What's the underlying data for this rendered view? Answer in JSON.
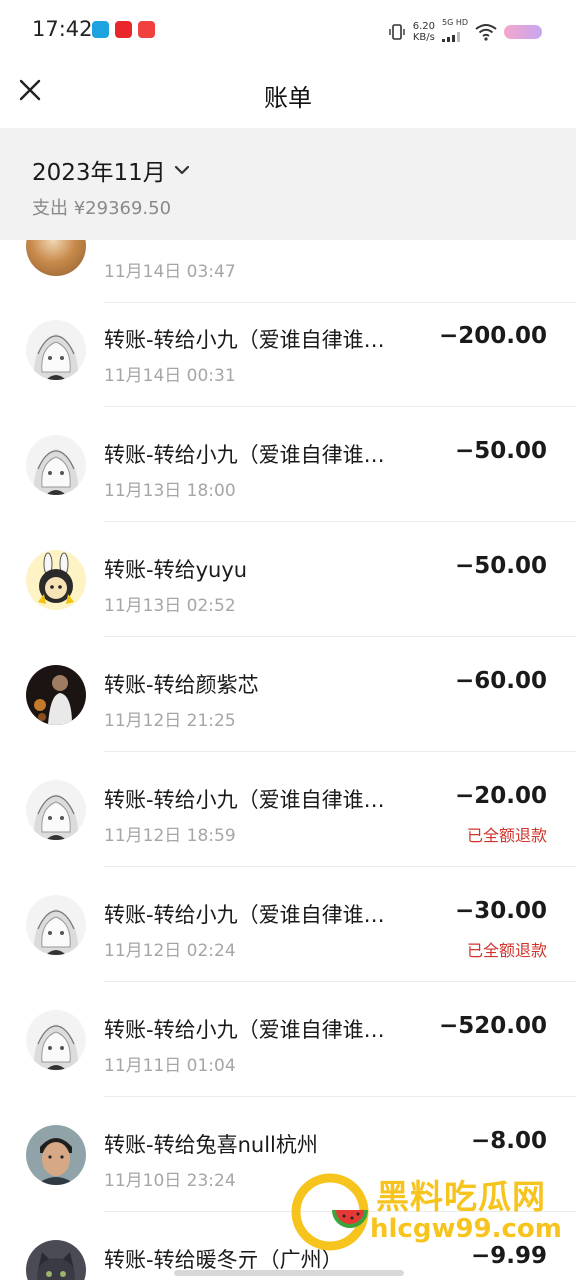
{
  "status_bar": {
    "time": "17:42",
    "net_speed": "6.20",
    "net_unit": "KB/s",
    "net_type": "5G HD",
    "app_colors": [
      "#1fa3e0",
      "#e8262c",
      "#f04040"
    ]
  },
  "header": {
    "title": "账单",
    "close_icon": "close-icon"
  },
  "summary": {
    "month": "2023年11月",
    "expense_label": "支出 ¥29369.50"
  },
  "transactions": [
    {
      "title": "",
      "time": "11月14日 03:47",
      "amount": "",
      "refund": "",
      "avatar": "orange-photo"
    },
    {
      "title": "转账-转给小九（爱谁自律谁…",
      "time": "11月14日 00:31",
      "amount": "−200.00",
      "refund": "",
      "avatar": "anime-sketch"
    },
    {
      "title": "转账-转给小九（爱谁自律谁…",
      "time": "11月13日 18:00",
      "amount": "−50.00",
      "refund": "",
      "avatar": "anime-sketch"
    },
    {
      "title": "转账-转给yuyu",
      "time": "11月13日 02:52",
      "amount": "−50.00",
      "refund": "",
      "avatar": "bunny-cartoon"
    },
    {
      "title": "转账-转给颜紫芯",
      "time": "11月12日 21:25",
      "amount": "−60.00",
      "refund": "",
      "avatar": "dark-photo"
    },
    {
      "title": "转账-转给小九（爱谁自律谁…",
      "time": "11月12日 18:59",
      "amount": "−20.00",
      "refund": "已全额退款",
      "avatar": "anime-sketch"
    },
    {
      "title": "转账-转给小九（爱谁自律谁…",
      "time": "11月12日 02:24",
      "amount": "−30.00",
      "refund": "已全额退款",
      "avatar": "anime-sketch"
    },
    {
      "title": "转账-转给小九（爱谁自律谁…",
      "time": "11月11日 01:04",
      "amount": "−520.00",
      "refund": "",
      "avatar": "anime-sketch"
    },
    {
      "title": "转账-转给兔喜null杭州",
      "time": "11月10日 23:24",
      "amount": "−8.00",
      "refund": "",
      "avatar": "man-photo"
    },
    {
      "title": "转账-转给暖冬亓（广州）",
      "time": "",
      "amount": "−9.99",
      "refund": "",
      "avatar": "cat-photo"
    }
  ],
  "watermark": {
    "line1": "黑料吃瓜网",
    "line2": "hlcgw99.com"
  },
  "colors": {
    "refund": "#d0342c",
    "summary_bg": "#f2f2f2",
    "watermark": "#f7c31d"
  }
}
